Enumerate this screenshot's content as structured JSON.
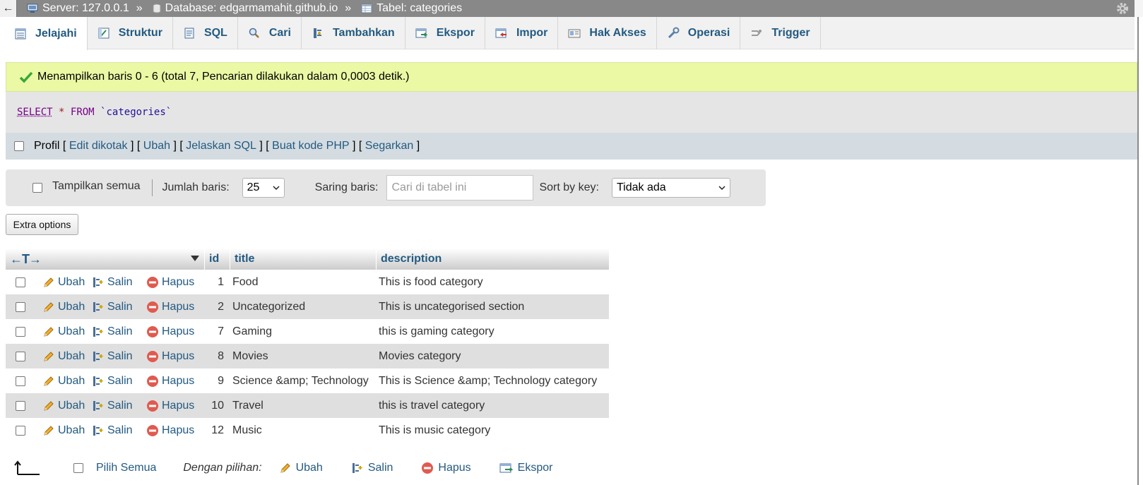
{
  "breadcrumb": {
    "server": "Server: 127.0.0.1",
    "database": "Database: edgarmamahit.github.io",
    "table": "Tabel: categories",
    "separator": "»"
  },
  "tabs": [
    {
      "label": "Jelajahi",
      "icon": "browse-icon",
      "active": true
    },
    {
      "label": "Struktur",
      "icon": "structure-icon"
    },
    {
      "label": "SQL",
      "icon": "sql-icon"
    },
    {
      "label": "Cari",
      "icon": "search-icon"
    },
    {
      "label": "Tambahkan",
      "icon": "insert-icon"
    },
    {
      "label": "Ekspor",
      "icon": "export-icon"
    },
    {
      "label": "Impor",
      "icon": "import-icon"
    },
    {
      "label": "Hak Akses",
      "icon": "privileges-icon"
    },
    {
      "label": "Operasi",
      "icon": "operations-icon"
    },
    {
      "label": "Trigger",
      "icon": "trigger-icon"
    }
  ],
  "success_message": "Menampilkan baris 0 - 6 (total 7, Pencarian dilakukan dalam 0,0003 detik.)",
  "sql": {
    "select": "SELECT",
    "star": "*",
    "from": "FROM",
    "table": "`categories`"
  },
  "profile": {
    "label": "Profil",
    "links": [
      "Edit dikotak",
      "Ubah",
      "Jelaskan SQL",
      "Buat kode PHP",
      "Segarkan"
    ],
    "open": "[",
    "mid": "] [",
    "close": "]"
  },
  "nav": {
    "show_all": "Tampilkan semua",
    "rows_label": "Jumlah baris:",
    "rows_value": "25",
    "filter_label": "Saring baris:",
    "filter_placeholder": "Cari di tabel ini",
    "sort_label": "Sort by key:",
    "sort_value": "Tidak ada"
  },
  "extra_options": "Extra options",
  "table": {
    "arrows": "←T→",
    "columns": {
      "id": "id",
      "title": "title",
      "description": "description"
    },
    "actions": {
      "edit": "Ubah",
      "copy": "Salin",
      "delete": "Hapus"
    },
    "rows": [
      {
        "id": "1",
        "title": "Food",
        "description": "This is food category"
      },
      {
        "id": "2",
        "title": "Uncategorized",
        "description": "This is uncategorised section"
      },
      {
        "id": "7",
        "title": "Gaming",
        "description": "this is gaming category"
      },
      {
        "id": "8",
        "title": "Movies",
        "description": "Movies category"
      },
      {
        "id": "9",
        "title": "Science &amp; Technology",
        "description": "This is Science &amp; Technology category"
      },
      {
        "id": "10",
        "title": "Travel",
        "description": "this is travel category"
      },
      {
        "id": "12",
        "title": "Music",
        "description": "This is music category"
      }
    ]
  },
  "bottom": {
    "select_all": "Pilih Semua",
    "with_selected": "Dengan pilihan:",
    "edit": "Ubah",
    "copy": "Salin",
    "delete": "Hapus",
    "export": "Ekspor"
  },
  "colors": {
    "link": "#235a81",
    "success_bg": "#ebf8a4",
    "top_bar": "#888888"
  }
}
